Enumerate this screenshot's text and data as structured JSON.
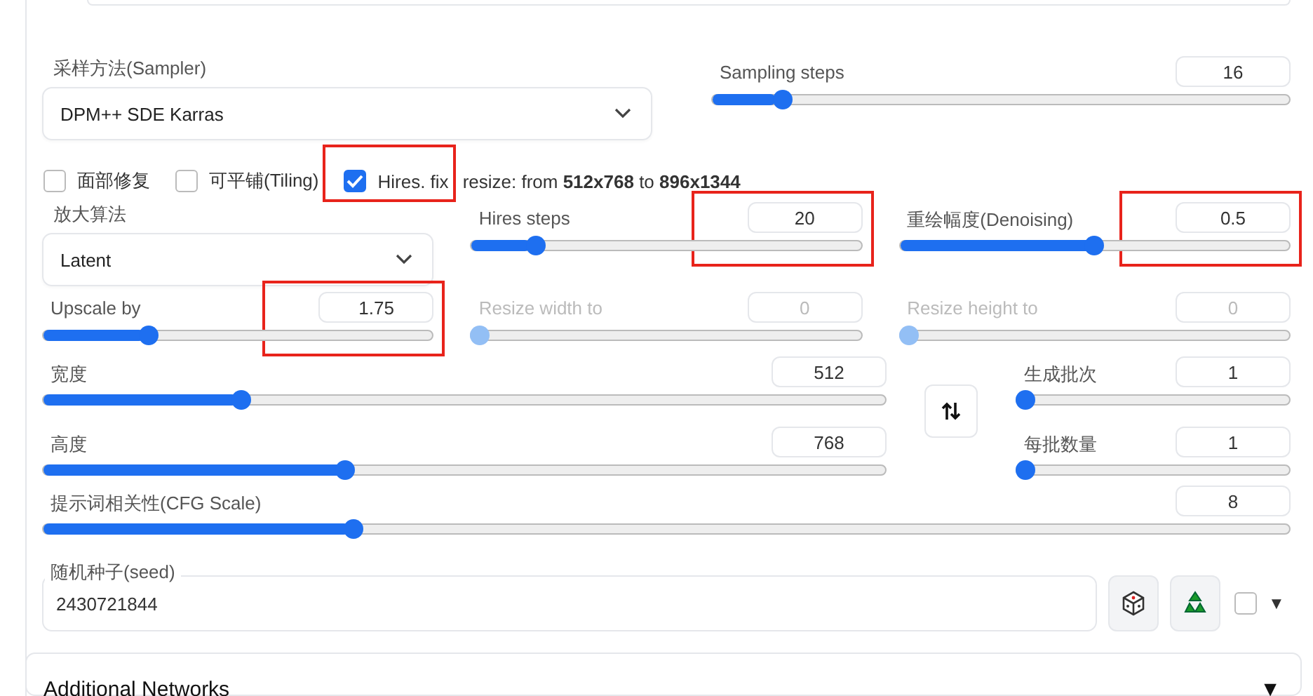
{
  "sampler": {
    "label": "采样方法(Sampler)",
    "value": "DPM++ SDE Karras"
  },
  "sampling_steps": {
    "label": "Sampling steps",
    "value": "16",
    "level": 0.11,
    "disabled": false,
    "highlighted": false
  },
  "options": [
    {
      "label": "面部修复",
      "checked": false,
      "highlighted": false
    },
    {
      "label": "可平铺(Tiling)",
      "checked": false,
      "highlighted": false
    },
    {
      "label": "Hires. fix",
      "checked": true,
      "highlighted": true
    }
  ],
  "resize_note": "resize: from **512x768** to **896x1344**",
  "upscaler": {
    "label": "放大算法",
    "value": "Latent"
  },
  "hires_steps": {
    "label": "Hires steps",
    "value": "20",
    "level": 0.15,
    "disabled": false,
    "highlighted": true
  },
  "denoising": {
    "label": "重绘幅度(Denoising)",
    "value": "0.5",
    "level": 0.5,
    "disabled": false,
    "highlighted": true
  },
  "upscale_by": {
    "label": "Upscale by",
    "value": "1.75",
    "level": 0.26,
    "disabled": false,
    "highlighted": true
  },
  "resize_width": {
    "label": "Resize width to",
    "value": "0",
    "level": 0,
    "disabled": true,
    "highlighted": false
  },
  "resize_height": {
    "label": "Resize height to",
    "value": "0",
    "level": 0,
    "disabled": true,
    "highlighted": false
  },
  "width": {
    "label": "宽度",
    "value": "512",
    "level": 0.23,
    "disabled": false,
    "highlighted": false
  },
  "height": {
    "label": "高度",
    "value": "768",
    "level": 0.356,
    "disabled": false,
    "highlighted": false
  },
  "batch_count": {
    "label": "生成批次",
    "value": "1",
    "level": 0,
    "disabled": false,
    "highlighted": false
  },
  "batch_size": {
    "label": "每批数量",
    "value": "1",
    "level": 0,
    "disabled": false,
    "highlighted": false
  },
  "cfg_scale": {
    "label": "提示词相关性(CFG Scale)",
    "value": "8",
    "level": 0.245,
    "disabled": false,
    "highlighted": false
  },
  "seed": {
    "label": "随机种子(seed)",
    "value": "2430721844",
    "extra_checked": false,
    "extra_toggle": "▼"
  },
  "additional_networks": {
    "title": "Additional Networks",
    "toggle": "▼"
  }
}
